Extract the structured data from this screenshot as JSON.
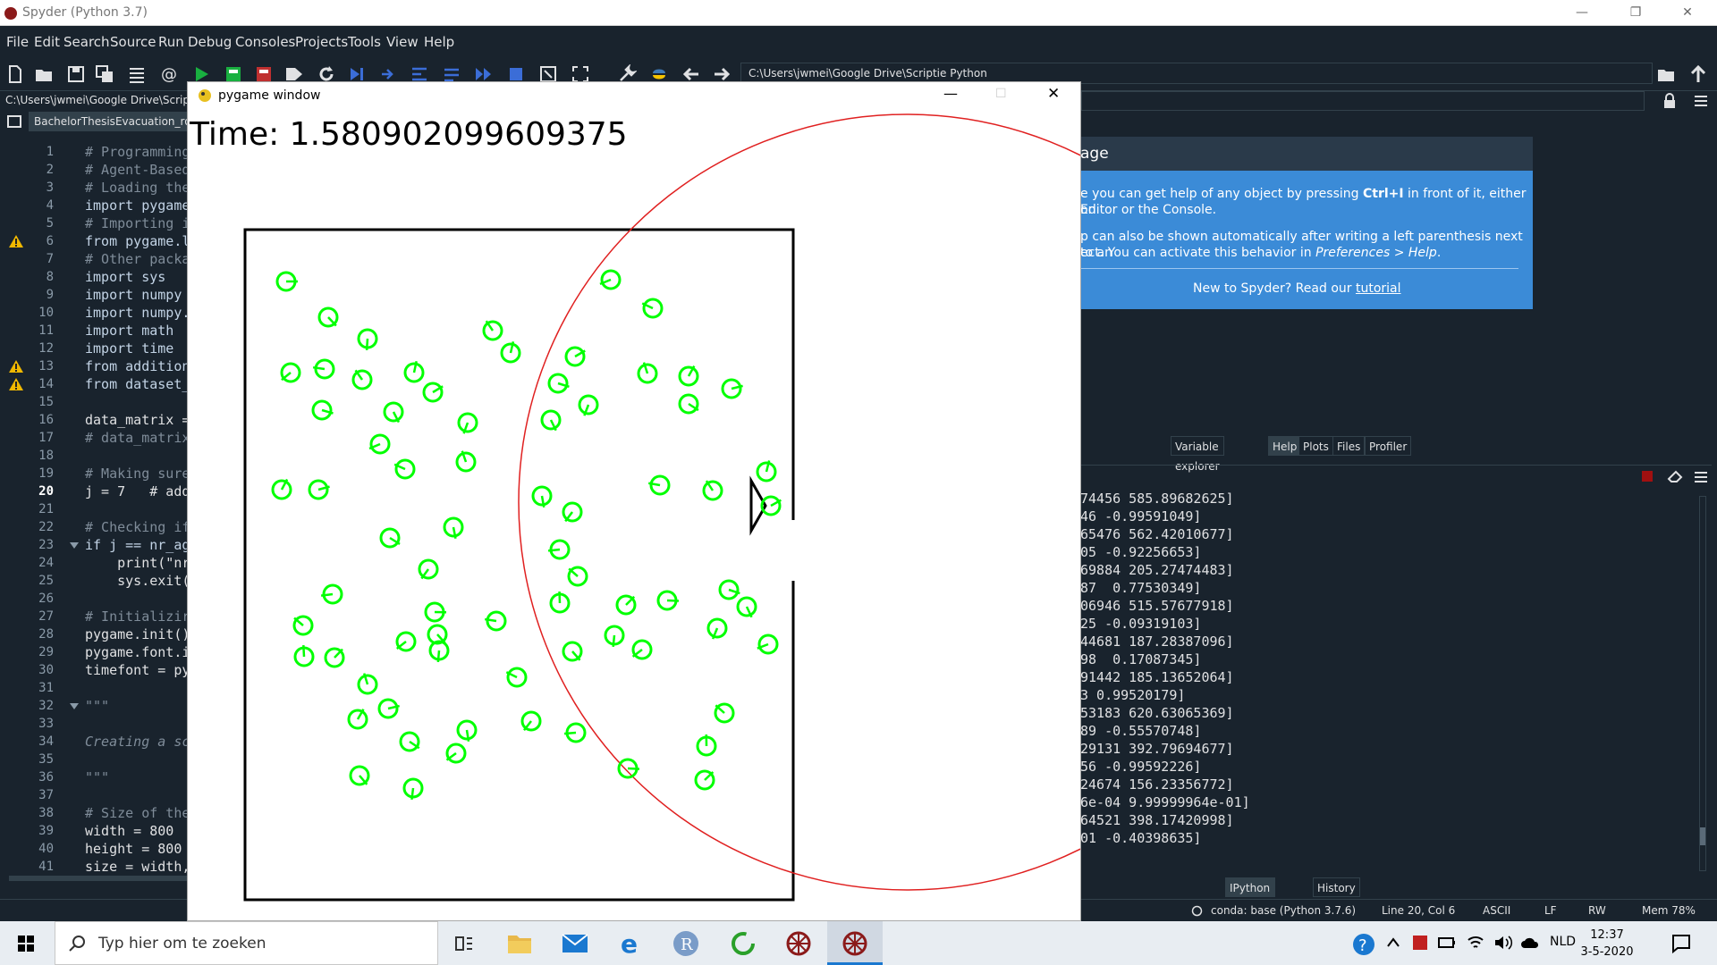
{
  "window": {
    "title": "Spyder (Python 3.7)",
    "minimize": "—",
    "restore": "❐",
    "close": "✕"
  },
  "menu": [
    "File",
    "Edit",
    "Search",
    "Source",
    "Run",
    "Debug",
    "Consoles",
    "Projects",
    "Tools",
    "View",
    "Help"
  ],
  "toolbar": {
    "working_dir": "C:\\Users\\jwmei\\Google Drive\\Scriptie Python"
  },
  "editor": {
    "path": "C:\\Users\\jwmei\\Google Drive\\Scrip",
    "tab": "BachelorThesisEvacuation_ro",
    "lines": [
      {
        "n": "1",
        "t": "# Programming",
        "c": "comment"
      },
      {
        "n": "2",
        "t": "# Agent-Based",
        "c": "comment"
      },
      {
        "n": "3",
        "t": "# Loading the",
        "c": "comment"
      },
      {
        "n": "4",
        "t": "import pygame",
        "c": "kw"
      },
      {
        "n": "5",
        "t": "# Importing i",
        "c": "comment"
      },
      {
        "n": "6",
        "t": "from pygame.l",
        "c": "kw"
      },
      {
        "n": "7",
        "t": "# Other packa",
        "c": "comment"
      },
      {
        "n": "8",
        "t": "import sys",
        "c": "kw"
      },
      {
        "n": "9",
        "t": "import numpy",
        "c": "kw"
      },
      {
        "n": "10",
        "t": "import numpy.",
        "c": "kw"
      },
      {
        "n": "11",
        "t": "import math",
        "c": "kw"
      },
      {
        "n": "12",
        "t": "import time",
        "c": "kw"
      },
      {
        "n": "13",
        "t": "from addition",
        "c": "kw"
      },
      {
        "n": "14",
        "t": "from dataset_",
        "c": "kw"
      },
      {
        "n": "15",
        "t": "",
        "c": ""
      },
      {
        "n": "16",
        "t": "data_matrix =",
        "c": ""
      },
      {
        "n": "17",
        "t": "# data_matrix",
        "c": "comment"
      },
      {
        "n": "18",
        "t": "",
        "c": ""
      },
      {
        "n": "19",
        "t": "# Making sure",
        "c": "comment"
      },
      {
        "n": "20",
        "t": "j = 7   # add",
        "c": ""
      },
      {
        "n": "21",
        "t": "",
        "c": ""
      },
      {
        "n": "22",
        "t": "# Checking if",
        "c": "comment"
      },
      {
        "n": "23",
        "t": "if j == nr_ag",
        "c": "kw"
      },
      {
        "n": "24",
        "t": "    print(\"nr",
        "c": ""
      },
      {
        "n": "25",
        "t": "    sys.exit(",
        "c": ""
      },
      {
        "n": "26",
        "t": "",
        "c": ""
      },
      {
        "n": "27",
        "t": "# Initializir",
        "c": "comment"
      },
      {
        "n": "28",
        "t": "pygame.init()",
        "c": ""
      },
      {
        "n": "29",
        "t": "pygame.font.i",
        "c": ""
      },
      {
        "n": "30",
        "t": "timefont = py",
        "c": ""
      },
      {
        "n": "31",
        "t": "",
        "c": ""
      },
      {
        "n": "32",
        "t": "\"\"\"",
        "c": "italic"
      },
      {
        "n": "33",
        "t": "",
        "c": ""
      },
      {
        "n": "34",
        "t": "Creating a sc",
        "c": "italic"
      },
      {
        "n": "35",
        "t": "",
        "c": ""
      },
      {
        "n": "36",
        "t": "\"\"\"",
        "c": "italic"
      },
      {
        "n": "37",
        "t": "",
        "c": ""
      },
      {
        "n": "38",
        "t": "# Size of the",
        "c": "comment"
      },
      {
        "n": "39",
        "t": "width = 800",
        "c": ""
      },
      {
        "n": "40",
        "t": "height = 800",
        "c": ""
      },
      {
        "n": "41",
        "t": "size = width,",
        "c": ""
      }
    ],
    "current_line": "20"
  },
  "help": {
    "title": "age",
    "p1_pre": "e you can get help of any object by pressing ",
    "p1_key": "Ctrl+I",
    "p1_post": " in front of it, either on",
    "p1_line2": "Editor or the Console.",
    "p2_line1": "p can also be shown automatically after writing a left parenthesis next to an",
    "p2_line2_pre": "ect. You can activate this behavior in ",
    "p2_line2_em": "Preferences > Help",
    "p2_line2_post": ".",
    "p3_pre": "New to Spyder? Read our ",
    "p3_link": "tutorial"
  },
  "pane_tabs": [
    "Variable explorer",
    "Help",
    "Plots",
    "Files",
    "Profiler"
  ],
  "pane_tab_active": "Help",
  "console_lines": [
    "74456 585.89682625]",
    "46 -0.99591049]",
    "65476 562.42010677]",
    "05 -0.92256653]",
    "69884 205.27474483]",
    "87  0.77530349]",
    "06946 515.57677918]",
    "25 -0.09319103]",
    "44681 187.28387096]",
    "98  0.17087345]",
    "91442 185.13652064]",
    "3 0.99520179]",
    "53183 620.63065369]",
    "89 -0.55570748]",
    "29131 392.79694677]",
    "56 -0.99592226]",
    "24674 156.23356772]",
    "6e-04 9.99999964e-01]",
    "64521 398.17420998]",
    "01 -0.40398635]"
  ],
  "console_tabs": [
    "IPython console",
    "History"
  ],
  "status": {
    "conda": "conda: base (Python 3.7.6)",
    "position": "Line 20, Col 6",
    "encoding": "ASCII",
    "eol": "LF",
    "perm": "RW",
    "mem": "Mem 78%"
  },
  "pygame": {
    "title": "pygame window",
    "time_label": "Time: 1.580902099609375",
    "agent_color": "#00ff00",
    "circle_color": "#e02020"
  },
  "taskbar": {
    "search_placeholder": "Typ hier om te zoeken",
    "language": "NLD",
    "time": "12:37",
    "date": "3-5-2020"
  }
}
